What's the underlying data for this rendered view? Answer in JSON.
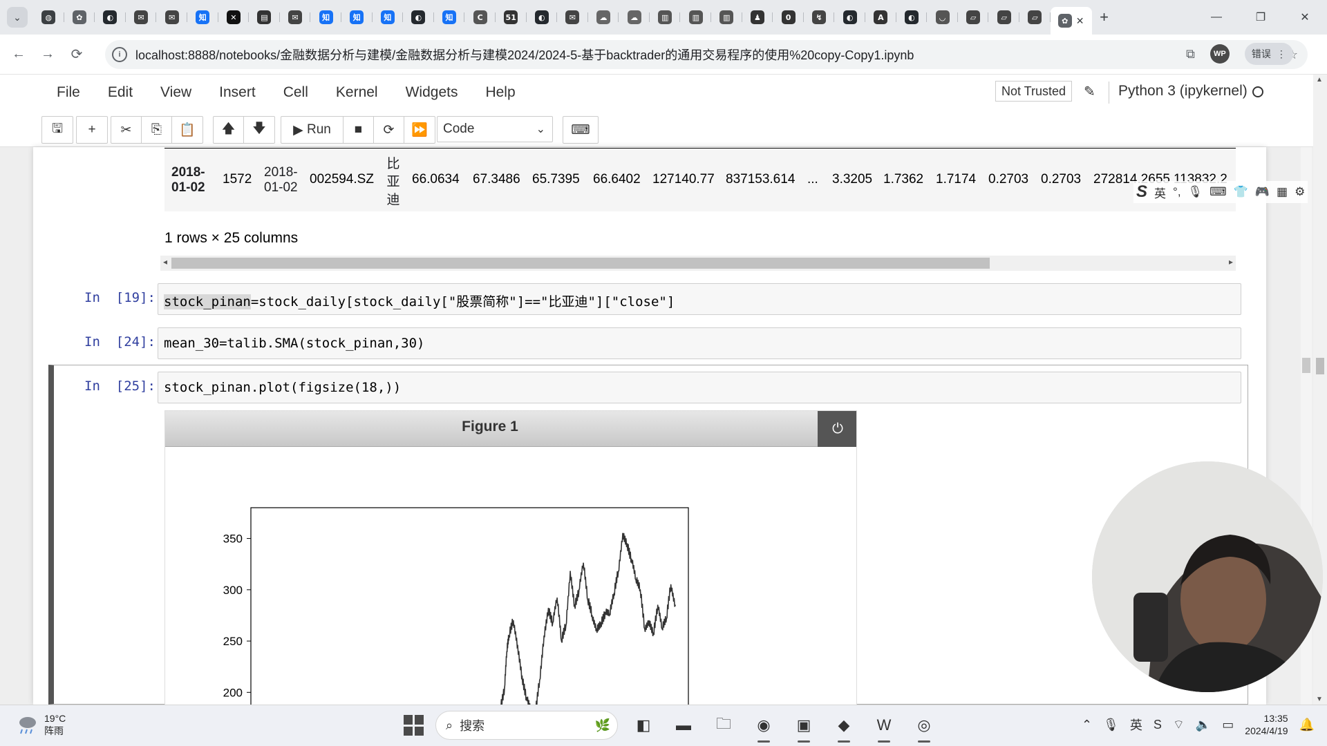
{
  "browser": {
    "tab_icons": [
      "ai-icon",
      "gear-icon",
      "github-icon",
      "mail-icon",
      "mail-icon",
      "zhihu-icon",
      "x-icon",
      "book-icon",
      "mail-icon",
      "zhihu-icon",
      "zhihu-icon",
      "zhihu-icon",
      "github-icon",
      "zhihu-icon",
      "c-icon",
      "51-icon",
      "github-icon",
      "mail-icon",
      "cloud-icon",
      "cloud-icon",
      "doc-icon",
      "doc-icon",
      "doc-icon",
      "qq-icon",
      "n-icon",
      "flow-icon",
      "github-icon",
      "a-icon",
      "github-icon",
      "loop-icon",
      "note-icon",
      "note-icon",
      "note-icon",
      "jupyter-icon"
    ],
    "tab_icon_labels": [
      "◍",
      "✿",
      "◐",
      "✉",
      "✉",
      "知",
      "✕",
      "▤",
      "✉",
      "知",
      "知",
      "知",
      "◐",
      "知",
      "C",
      "51",
      "◐",
      "✉",
      "☁",
      "☁",
      "▥",
      "▥",
      "▥",
      "♟",
      "0",
      "↯",
      "◐",
      "A",
      "◐",
      "◡",
      "▱",
      "▱",
      "▱",
      "✿"
    ],
    "address": "localhost:8888/notebooks/金融数据分析与建模/金融数据分析与建模2024/2024-5-基于backtrader的通用交易程序的使用%20copy-Copy1.ipynb",
    "profile_initials": "WP",
    "error_label": "错误"
  },
  "jupyter": {
    "menus": [
      "File",
      "Edit",
      "View",
      "Insert",
      "Cell",
      "Kernel",
      "Widgets",
      "Help"
    ],
    "trust_status": "Not Trusted",
    "kernel_name": "Python 3 (ipykernel)",
    "toolbar": {
      "run_label": "Run",
      "cell_type": "Code"
    }
  },
  "output_table": {
    "index_top": "2018-",
    "index_bottom": "01-02",
    "cells": [
      "1572",
      "002594.SZ",
      "66.0634",
      "67.3486",
      "65.7395",
      "66.6402",
      "127140.77",
      "837153.614",
      "...",
      "3.3205",
      "1.7362",
      "1.7174",
      "0.2703",
      "0.2703",
      "272814.2655",
      "113832.2"
    ],
    "date_top": "2018-",
    "date_bottom": "01-02",
    "name_chars": [
      "比",
      "亚",
      "迪"
    ],
    "shape_info": "1 rows × 25 columns"
  },
  "cells": [
    {
      "prompt": "In  [19]:",
      "code_highlight": "stock_pinan",
      "code_rest": "=stock_daily[stock_daily[\"股票简称\"]==\"比亚迪\"][\"close\"]"
    },
    {
      "prompt": "In  [24]:",
      "code": "mean_30=talib.SMA(stock_pinan,30)"
    },
    {
      "prompt": "In  [25]:",
      "code": "stock_pinan.plot(figsize(18,))"
    }
  ],
  "figure": {
    "title": "Figure 1"
  },
  "chart_data": {
    "type": "line",
    "title": "",
    "xlabel": "",
    "ylabel": "",
    "yticks": [
      350,
      300,
      250,
      200
    ],
    "ylim": [
      178,
      380
    ],
    "x_range": [
      0,
      1
    ],
    "x": [
      0.55,
      0.57,
      0.58,
      0.585,
      0.59,
      0.6,
      0.61,
      0.62,
      0.63,
      0.64,
      0.65,
      0.66,
      0.67,
      0.68,
      0.69,
      0.7,
      0.71,
      0.72,
      0.73,
      0.74,
      0.75,
      0.76,
      0.77,
      0.78,
      0.79,
      0.8,
      0.81,
      0.82,
      0.83,
      0.84,
      0.85,
      0.86,
      0.87,
      0.88,
      0.89,
      0.9,
      0.91,
      0.92,
      0.93,
      0.94,
      0.95,
      0.96,
      0.97
    ],
    "values": [
      181,
      185,
      205,
      240,
      255,
      270,
      245,
      215,
      195,
      182,
      178,
      212,
      255,
      282,
      268,
      292,
      250,
      265,
      318,
      285,
      300,
      326,
      290,
      275,
      262,
      268,
      278,
      276,
      296,
      318,
      355,
      345,
      330,
      310,
      300,
      262,
      270,
      258,
      285,
      262,
      272,
      305,
      285
    ],
    "grid": false,
    "legend": "none"
  },
  "taskbar": {
    "temperature": "19°C",
    "weather": "阵雨",
    "search_placeholder": "搜索",
    "time": "13:35",
    "date": "2024/4/19",
    "ime_label": "英"
  }
}
